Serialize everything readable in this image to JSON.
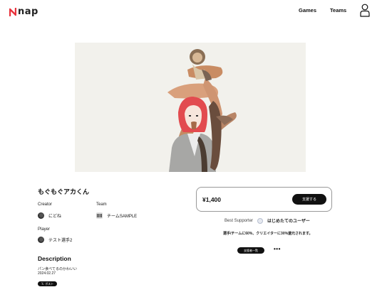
{
  "header": {
    "logo_text": "nap",
    "nav": [
      {
        "label": "Games"
      },
      {
        "label": "Teams"
      }
    ],
    "brand_color": "#e8323c"
  },
  "artwork": {
    "title": "もぐもぐアカくん"
  },
  "meta": {
    "creator_label": "Creator",
    "creator_name": "にどね",
    "team_label": "Team",
    "team_name": "チームSAMPLE",
    "player_label": "Player",
    "player_name": "テスト選手2"
  },
  "description": {
    "heading": "Description",
    "text": "パン食べてるのかわいい",
    "date": "2024.02.27",
    "post_label": "ポスト"
  },
  "purchase": {
    "price": "¥1,400",
    "support_button": "支援する",
    "best_supporter_label": "Best Supporter",
    "best_supporter_name": "はじめたてのユーザー",
    "ratio_text": "選手/チームに60%、クリエイターに30%還元されます。",
    "supporters_list_button": "支援者一覧",
    "more_label": "•••"
  }
}
